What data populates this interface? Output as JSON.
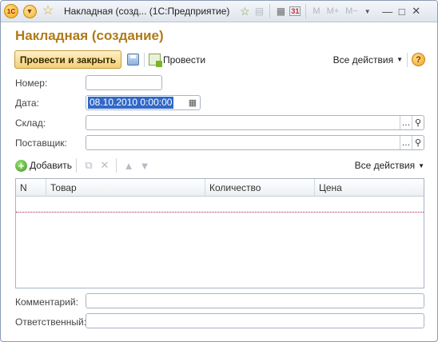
{
  "titlebar": {
    "logo_text": "1С",
    "title": "Накладная (созд... (1С:Предприятие)",
    "calc_icons": [
      "M",
      "M+",
      "M−"
    ],
    "calendar_number": "31"
  },
  "form": {
    "title": "Накладная (создание)",
    "commands": {
      "post_and_close": "Провести и закрыть",
      "post": "Провести",
      "all_actions": "Все действия",
      "help": "?"
    },
    "fields": {
      "number": {
        "label": "Номер:",
        "value": ""
      },
      "date": {
        "label": "Дата:",
        "value": "08.10.2010  0:00:00"
      },
      "warehouse": {
        "label": "Склад:",
        "value": ""
      },
      "supplier": {
        "label": "Поставщик:",
        "value": ""
      },
      "comment": {
        "label": "Комментарий:",
        "value": ""
      },
      "responsible": {
        "label": "Ответственный:",
        "value": ""
      }
    },
    "table_commands": {
      "add": "Добавить",
      "all_actions": "Все действия"
    },
    "table": {
      "columns": [
        "N",
        "Товар",
        "Количество",
        "Цена"
      ],
      "rows": []
    }
  }
}
